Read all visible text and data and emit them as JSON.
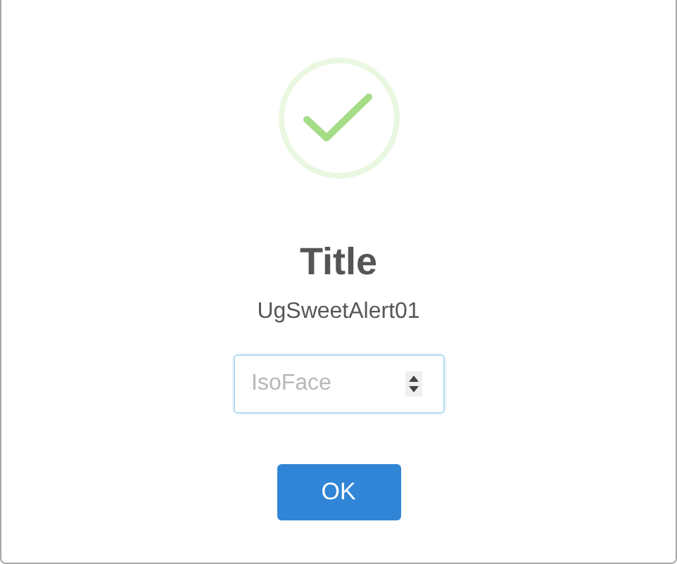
{
  "dialog": {
    "title": "Title",
    "text": "UgSweetAlert01",
    "input": {
      "placeholder": "IsoFace"
    },
    "buttons": [
      "OK"
    ]
  }
}
